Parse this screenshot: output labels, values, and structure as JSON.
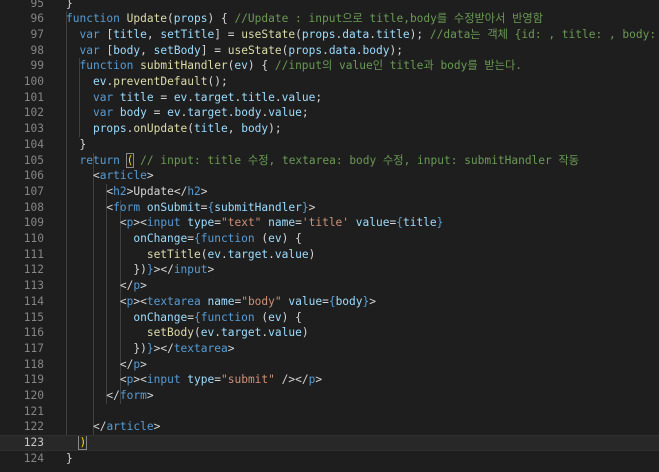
{
  "editor": {
    "language": "javascript-jsx",
    "theme_colors": {
      "background": "#1e1e1e",
      "keyword": "#569cd6",
      "function": "#dcdcaa",
      "variable": "#9cdcfe",
      "comment": "#6a9955",
      "string": "#ce9178",
      "text": "#d4d4d4",
      "line_number": "#858585"
    },
    "current_line": "123",
    "lines": [
      {
        "no": "95",
        "tokens": [
          [
            "pun",
            "}"
          ]
        ]
      },
      {
        "no": "96",
        "tokens": [
          [
            "kw",
            "function "
          ],
          [
            "fn",
            "Update"
          ],
          [
            "pun",
            "("
          ],
          [
            "var",
            "props"
          ],
          [
            "pun",
            ") { "
          ],
          [
            "cm",
            "//Update : input으로 title,body를 수정받아서 반영함"
          ]
        ]
      },
      {
        "no": "97",
        "tokens": [
          [
            "txt",
            "  "
          ],
          [
            "kw",
            "var "
          ],
          [
            "pun",
            "["
          ],
          [
            "var",
            "title"
          ],
          [
            "pun",
            ", "
          ],
          [
            "var",
            "setTitle"
          ],
          [
            "pun",
            "] = "
          ],
          [
            "fn",
            "useState"
          ],
          [
            "pun",
            "("
          ],
          [
            "var",
            "props"
          ],
          [
            "pun",
            "."
          ],
          [
            "var",
            "data"
          ],
          [
            "pun",
            "."
          ],
          [
            "var",
            "title"
          ],
          [
            "pun",
            "); "
          ],
          [
            "cm",
            "//data는 객체 {id: , title: , body: }"
          ]
        ]
      },
      {
        "no": "98",
        "tokens": [
          [
            "txt",
            "  "
          ],
          [
            "kw",
            "var "
          ],
          [
            "pun",
            "["
          ],
          [
            "var",
            "body"
          ],
          [
            "pun",
            ", "
          ],
          [
            "var",
            "setBody"
          ],
          [
            "pun",
            "] = "
          ],
          [
            "fn",
            "useState"
          ],
          [
            "pun",
            "("
          ],
          [
            "var",
            "props"
          ],
          [
            "pun",
            "."
          ],
          [
            "var",
            "data"
          ],
          [
            "pun",
            "."
          ],
          [
            "var",
            "body"
          ],
          [
            "pun",
            ");"
          ]
        ]
      },
      {
        "no": "99",
        "tokens": [
          [
            "txt",
            "  "
          ],
          [
            "kw",
            "function "
          ],
          [
            "fn",
            "submitHandler"
          ],
          [
            "pun",
            "("
          ],
          [
            "var",
            "ev"
          ],
          [
            "pun",
            ") { "
          ],
          [
            "cm",
            "//input의 value인 title과 body를 받는다."
          ]
        ]
      },
      {
        "no": "100",
        "tokens": [
          [
            "txt",
            "    "
          ],
          [
            "var",
            "ev"
          ],
          [
            "pun",
            "."
          ],
          [
            "fn",
            "preventDefault"
          ],
          [
            "pun",
            "();"
          ]
        ]
      },
      {
        "no": "101",
        "tokens": [
          [
            "txt",
            "    "
          ],
          [
            "kw",
            "var "
          ],
          [
            "var",
            "title"
          ],
          [
            "pun",
            " = "
          ],
          [
            "var",
            "ev"
          ],
          [
            "pun",
            "."
          ],
          [
            "var",
            "target"
          ],
          [
            "pun",
            "."
          ],
          [
            "var",
            "title"
          ],
          [
            "pun",
            "."
          ],
          [
            "var",
            "value"
          ],
          [
            "pun",
            ";"
          ]
        ]
      },
      {
        "no": "102",
        "tokens": [
          [
            "txt",
            "    "
          ],
          [
            "kw",
            "var "
          ],
          [
            "var",
            "body"
          ],
          [
            "pun",
            " = "
          ],
          [
            "var",
            "ev"
          ],
          [
            "pun",
            "."
          ],
          [
            "var",
            "target"
          ],
          [
            "pun",
            "."
          ],
          [
            "var",
            "body"
          ],
          [
            "pun",
            "."
          ],
          [
            "var",
            "value"
          ],
          [
            "pun",
            ";"
          ]
        ]
      },
      {
        "no": "103",
        "tokens": [
          [
            "txt",
            "    "
          ],
          [
            "var",
            "props"
          ],
          [
            "pun",
            "."
          ],
          [
            "fn",
            "onUpdate"
          ],
          [
            "pun",
            "("
          ],
          [
            "var",
            "title"
          ],
          [
            "pun",
            ", "
          ],
          [
            "var",
            "body"
          ],
          [
            "pun",
            ");"
          ]
        ]
      },
      {
        "no": "104",
        "tokens": [
          [
            "txt",
            "  "
          ],
          [
            "pun",
            "}"
          ]
        ]
      },
      {
        "no": "105",
        "tokens": [
          [
            "txt",
            "  "
          ],
          [
            "kw",
            "return "
          ],
          [
            "br",
            "("
          ],
          [
            "pun",
            " "
          ],
          [
            "cm",
            "// input: title 수정, textarea: body 수정, input: submitHandler 작동"
          ]
        ]
      },
      {
        "no": "106",
        "tokens": [
          [
            "txt",
            "    "
          ],
          [
            "pun",
            "<"
          ],
          [
            "tag",
            "article"
          ],
          [
            "pun",
            ">"
          ]
        ]
      },
      {
        "no": "107",
        "tokens": [
          [
            "txt",
            "      "
          ],
          [
            "pun",
            "<"
          ],
          [
            "tag",
            "h2"
          ],
          [
            "pun",
            ">"
          ],
          [
            "txt",
            "Update"
          ],
          [
            "pun",
            "</"
          ],
          [
            "tag",
            "h2"
          ],
          [
            "pun",
            ">"
          ]
        ]
      },
      {
        "no": "108",
        "tokens": [
          [
            "txt",
            "      "
          ],
          [
            "pun",
            "<"
          ],
          [
            "tag",
            "form "
          ],
          [
            "attr",
            "onSubmit"
          ],
          [
            "pun",
            "="
          ],
          [
            "kw",
            "{"
          ],
          [
            "var",
            "submitHandler"
          ],
          [
            "kw",
            "}"
          ],
          [
            "pun",
            ">"
          ]
        ]
      },
      {
        "no": "109",
        "tokens": [
          [
            "txt",
            "        "
          ],
          [
            "pun",
            "<"
          ],
          [
            "tag",
            "p"
          ],
          [
            "pun",
            "><"
          ],
          [
            "tag",
            "input "
          ],
          [
            "attr",
            "type"
          ],
          [
            "pun",
            "="
          ],
          [
            "str",
            "\"text\""
          ],
          [
            "pun",
            " "
          ],
          [
            "attr",
            "name"
          ],
          [
            "pun",
            "="
          ],
          [
            "str",
            "'title'"
          ],
          [
            "pun",
            " "
          ],
          [
            "attr",
            "value"
          ],
          [
            "pun",
            "="
          ],
          [
            "kw",
            "{"
          ],
          [
            "var",
            "title"
          ],
          [
            "kw",
            "}"
          ]
        ]
      },
      {
        "no": "110",
        "tokens": [
          [
            "txt",
            "          "
          ],
          [
            "attr",
            "onChange"
          ],
          [
            "pun",
            "="
          ],
          [
            "kw",
            "{function "
          ],
          [
            "pun",
            "("
          ],
          [
            "var",
            "ev"
          ],
          [
            "pun",
            ") {"
          ]
        ]
      },
      {
        "no": "111",
        "tokens": [
          [
            "txt",
            "            "
          ],
          [
            "fn",
            "setTitle"
          ],
          [
            "pun",
            "("
          ],
          [
            "var",
            "ev"
          ],
          [
            "pun",
            "."
          ],
          [
            "var",
            "target"
          ],
          [
            "pun",
            "."
          ],
          [
            "var",
            "value"
          ],
          [
            "pun",
            ")"
          ]
        ]
      },
      {
        "no": "112",
        "tokens": [
          [
            "txt",
            "          "
          ],
          [
            "pun",
            "})"
          ],
          [
            "kw",
            "}"
          ],
          [
            "pun",
            "></"
          ],
          [
            "tag",
            "input"
          ],
          [
            "pun",
            ">"
          ]
        ]
      },
      {
        "no": "113",
        "tokens": [
          [
            "txt",
            "        "
          ],
          [
            "pun",
            "</"
          ],
          [
            "tag",
            "p"
          ],
          [
            "pun",
            ">"
          ]
        ]
      },
      {
        "no": "114",
        "tokens": [
          [
            "txt",
            "        "
          ],
          [
            "pun",
            "<"
          ],
          [
            "tag",
            "p"
          ],
          [
            "pun",
            "><"
          ],
          [
            "tag",
            "textarea "
          ],
          [
            "attr",
            "name"
          ],
          [
            "pun",
            "="
          ],
          [
            "str",
            "\"body\""
          ],
          [
            "pun",
            " "
          ],
          [
            "attr",
            "value"
          ],
          [
            "pun",
            "="
          ],
          [
            "kw",
            "{"
          ],
          [
            "var",
            "body"
          ],
          [
            "kw",
            "}"
          ],
          [
            "pun",
            ">"
          ]
        ]
      },
      {
        "no": "115",
        "tokens": [
          [
            "txt",
            "          "
          ],
          [
            "attr",
            "onChange"
          ],
          [
            "pun",
            "="
          ],
          [
            "kw",
            "{function "
          ],
          [
            "pun",
            "("
          ],
          [
            "var",
            "ev"
          ],
          [
            "pun",
            ") {"
          ]
        ]
      },
      {
        "no": "116",
        "tokens": [
          [
            "txt",
            "            "
          ],
          [
            "fn",
            "setBody"
          ],
          [
            "pun",
            "("
          ],
          [
            "var",
            "ev"
          ],
          [
            "pun",
            "."
          ],
          [
            "var",
            "target"
          ],
          [
            "pun",
            "."
          ],
          [
            "var",
            "value"
          ],
          [
            "pun",
            ")"
          ]
        ]
      },
      {
        "no": "117",
        "tokens": [
          [
            "txt",
            "          "
          ],
          [
            "pun",
            "})"
          ],
          [
            "kw",
            "}"
          ],
          [
            "pun",
            "></"
          ],
          [
            "tag",
            "textarea"
          ],
          [
            "pun",
            ">"
          ]
        ]
      },
      {
        "no": "118",
        "tokens": [
          [
            "txt",
            "        "
          ],
          [
            "pun",
            "</"
          ],
          [
            "tag",
            "p"
          ],
          [
            "pun",
            ">"
          ]
        ]
      },
      {
        "no": "119",
        "tokens": [
          [
            "txt",
            "        "
          ],
          [
            "pun",
            "<"
          ],
          [
            "tag",
            "p"
          ],
          [
            "pun",
            "><"
          ],
          [
            "tag",
            "input "
          ],
          [
            "attr",
            "type"
          ],
          [
            "pun",
            "="
          ],
          [
            "str",
            "\"submit\""
          ],
          [
            "pun",
            " /></"
          ],
          [
            "tag",
            "p"
          ],
          [
            "pun",
            ">"
          ]
        ]
      },
      {
        "no": "120",
        "tokens": [
          [
            "txt",
            "      "
          ],
          [
            "pun",
            "</"
          ],
          [
            "tag",
            "form"
          ],
          [
            "pun",
            ">"
          ]
        ]
      },
      {
        "no": "121",
        "tokens": []
      },
      {
        "no": "122",
        "tokens": [
          [
            "txt",
            "    "
          ],
          [
            "pun",
            "</"
          ],
          [
            "tag",
            "article"
          ],
          [
            "pun",
            ">"
          ]
        ]
      },
      {
        "no": "123",
        "tokens": [
          [
            "txt",
            "  "
          ],
          [
            "br",
            ")"
          ]
        ]
      },
      {
        "no": "124",
        "tokens": [
          [
            "pun",
            "}"
          ]
        ]
      }
    ]
  }
}
